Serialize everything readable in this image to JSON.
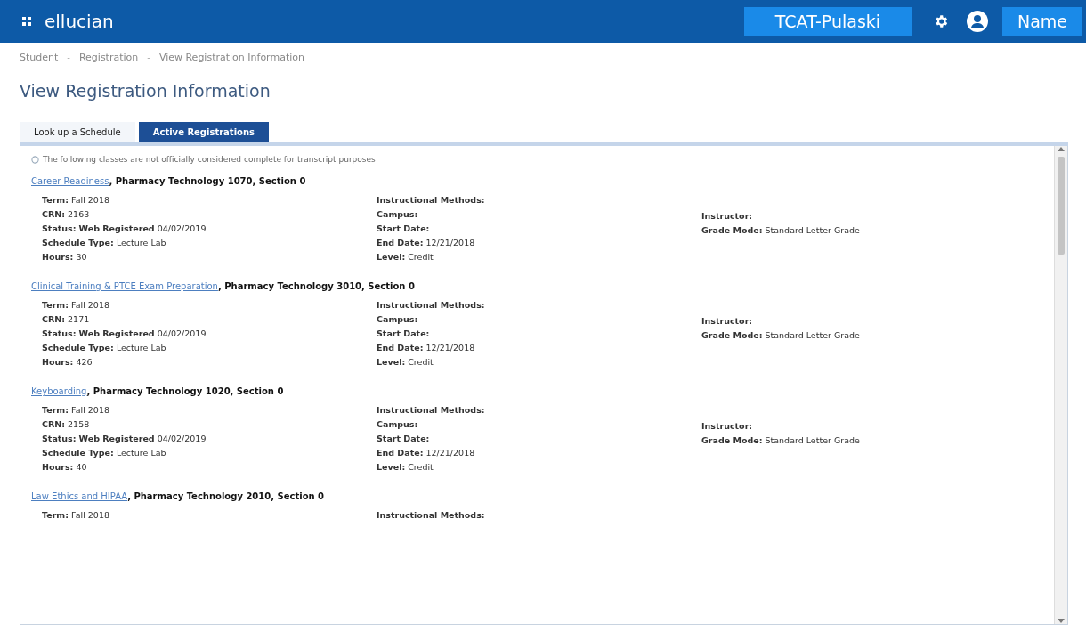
{
  "header": {
    "logo": "ellucian",
    "institution": "TCAT-Pulaski",
    "user": "Name"
  },
  "breadcrumbs": [
    "Student",
    "Registration",
    "View Registration Information"
  ],
  "breadcrumb_separator": "-",
  "title": "View Registration Information",
  "tabs": [
    {
      "label": "Look up a Schedule",
      "selected": false
    },
    {
      "label": "Active Registrations",
      "selected": true
    }
  ],
  "notice": "The following classes are not officially considered complete for transcript purposes",
  "courses": [
    {
      "title": "Career Readiness",
      "detail": ", Pharmacy Technology 1070, Section 0",
      "left": [
        {
          "label": "Term:",
          "value": "Fall 2018"
        },
        {
          "label": "CRN:",
          "value": "2163"
        },
        {
          "label": "Status:",
          "value": "**Web Registered** 04/02/2019"
        },
        {
          "label": "Schedule Type:",
          "value": "Lecture Lab"
        },
        {
          "label": "Hours:",
          "value": "30"
        }
      ],
      "middle": [
        {
          "label": "Instructional Methods:"
        },
        {
          "label": "Campus:"
        },
        {
          "label": "Start Date:"
        },
        {
          "label": "End Date:",
          "value": "12/21/2018"
        },
        {
          "label": "Level:",
          "value": "Credit"
        }
      ],
      "right": [
        {
          "label": "Instructor:"
        },
        {
          "label": "Grade Mode:",
          "value": "Standard Letter Grade"
        }
      ]
    },
    {
      "title": "Clinical Training & PTCE Exam Preparation",
      "detail": ", Pharmacy Technology 3010, Section 0",
      "left": [
        {
          "label": "Term:",
          "value": "Fall 2018"
        },
        {
          "label": "CRN:",
          "value": "2171"
        },
        {
          "label": "Status:",
          "value": "**Web Registered** 04/02/2019"
        },
        {
          "label": "Schedule Type:",
          "value": "Lecture Lab"
        },
        {
          "label": "Hours:",
          "value": "426"
        }
      ],
      "middle": [
        {
          "label": "Instructional Methods:"
        },
        {
          "label": "Campus:"
        },
        {
          "label": "Start Date:"
        },
        {
          "label": "End Date:",
          "value": "12/21/2018"
        },
        {
          "label": "Level:",
          "value": "Credit"
        }
      ],
      "right": [
        {
          "label": "Instructor:"
        },
        {
          "label": "Grade Mode:",
          "value": "Standard Letter Grade"
        }
      ]
    },
    {
      "title": "Keyboarding",
      "detail": ", Pharmacy Technology 1020, Section 0",
      "left": [
        {
          "label": "Term:",
          "value": "Fall 2018"
        },
        {
          "label": "CRN:",
          "value": "2158"
        },
        {
          "label": "Status:",
          "value": "**Web Registered** 04/02/2019"
        },
        {
          "label": "Schedule Type:",
          "value": "Lecture Lab"
        },
        {
          "label": "Hours:",
          "value": "40"
        }
      ],
      "middle": [
        {
          "label": "Instructional Methods:"
        },
        {
          "label": "Campus:"
        },
        {
          "label": "Start Date:"
        },
        {
          "label": "End Date:",
          "value": "12/21/2018"
        },
        {
          "label": "Level:",
          "value": "Credit"
        }
      ],
      "right": [
        {
          "label": "Instructor:"
        },
        {
          "label": "Grade Mode:",
          "value": "Standard Letter Grade"
        }
      ]
    },
    {
      "title": "Law Ethics and HIPAA",
      "detail": ", Pharmacy Technology 2010, Section 0",
      "left": [
        {
          "label": "Term:",
          "value": "Fall 2018"
        }
      ],
      "middle": [
        {
          "label": "Instructional Methods:"
        }
      ]
    }
  ]
}
